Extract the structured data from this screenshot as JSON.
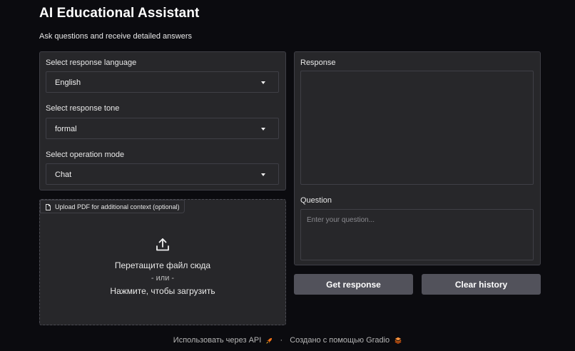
{
  "header": {
    "title": "AI Educational Assistant",
    "subtitle": "Ask questions and receive detailed answers"
  },
  "settings": {
    "language": {
      "label": "Select response language",
      "value": "English"
    },
    "tone": {
      "label": "Select response tone",
      "value": "formal"
    },
    "mode": {
      "label": "Select operation mode",
      "value": "Chat"
    }
  },
  "upload": {
    "label": "Upload PDF for additional context (optional)",
    "drop_text": "Перетащите файл сюда",
    "or_text": "- или -",
    "click_text": "Нажмите, чтобы загрузить"
  },
  "response": {
    "label": "Response",
    "value": ""
  },
  "question": {
    "label": "Question",
    "placeholder": "Enter your question..."
  },
  "buttons": {
    "get_response": "Get response",
    "clear_history": "Clear history"
  },
  "footer": {
    "api_link": "Использовать через API",
    "separator": "·",
    "built_with": "Создано с помощью Gradio"
  },
  "colors": {
    "background": "#0b0b0f",
    "panel": "#27272a",
    "border": "#3f3f46",
    "button": "#52525b",
    "gradio_accent": "#f97316"
  },
  "icons": {
    "upload": "upload-icon",
    "file": "file-icon",
    "dropdown": "chevron-down-icon",
    "api": "rocket-icon",
    "gradio": "gradio-logo-icon"
  }
}
